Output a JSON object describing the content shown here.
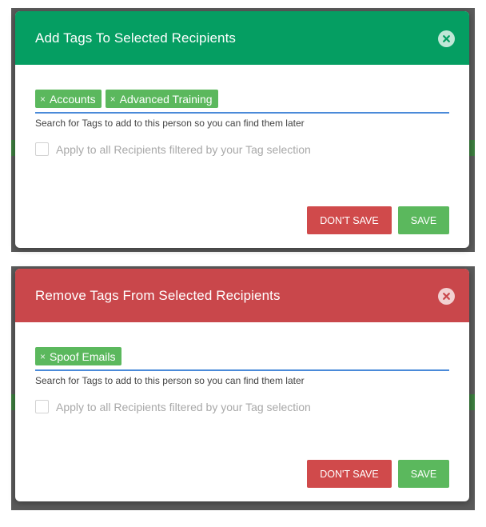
{
  "add_dialog": {
    "title": "Add Tags To Selected Recipients",
    "tags": [
      {
        "remove_glyph": "×",
        "label": "Accounts"
      },
      {
        "remove_glyph": "×",
        "label": "Advanced Training"
      }
    ],
    "helper_text": "Search for Tags to add to this person so you can find them later",
    "checkbox_label": "Apply to all Recipients filtered by your Tag selection",
    "dont_save_label": "DON'T SAVE",
    "save_label": "SAVE",
    "header_color": "#059e62"
  },
  "remove_dialog": {
    "title": "Remove Tags From Selected Recipients",
    "tags": [
      {
        "remove_glyph": "×",
        "label": "Spoof Emails"
      }
    ],
    "helper_text": "Search for Tags to add to this person so you can find them later",
    "checkbox_label": "Apply to all Recipients filtered by your Tag selection",
    "dont_save_label": "DON'T SAVE",
    "save_label": "SAVE",
    "header_color": "#c9474b"
  },
  "colors": {
    "tag_green": "#5bb85d",
    "danger_red": "#d04a4b",
    "input_underline": "#4a8ad9"
  },
  "icons": {
    "close": "close-icon",
    "tag_remove": "tag-remove-icon"
  }
}
